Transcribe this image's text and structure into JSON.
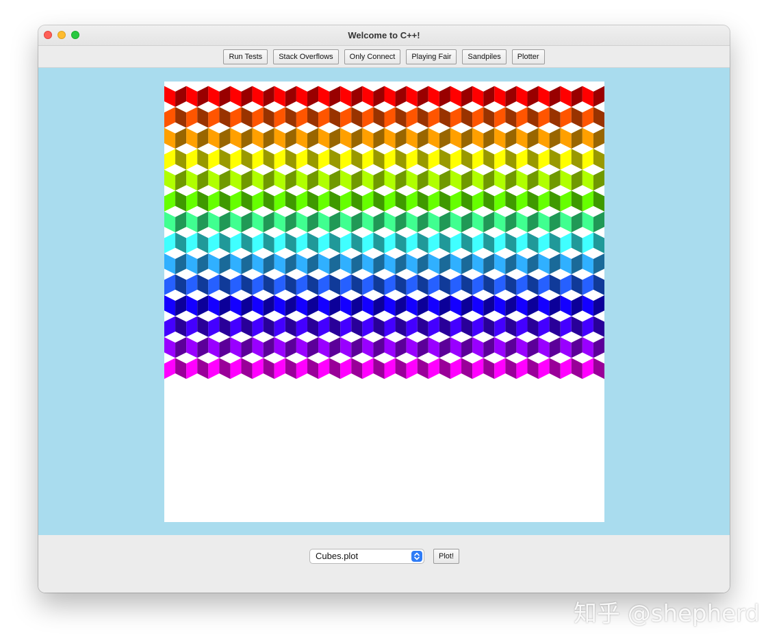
{
  "window": {
    "title": "Welcome to C++!"
  },
  "toolbar": {
    "buttons": [
      {
        "label": "Run Tests"
      },
      {
        "label": "Stack Overflows"
      },
      {
        "label": "Only Connect"
      },
      {
        "label": "Playing Fair"
      },
      {
        "label": "Sandpiles"
      },
      {
        "label": "Plotter"
      }
    ]
  },
  "plot": {
    "pattern": "isometric-cubes",
    "top_face_color": "#ffffff",
    "row_colors": [
      {
        "left": "#ff0000",
        "right": "#990000"
      },
      {
        "left": "#993300",
        "right": "#ff5500"
      },
      {
        "left": "#ffa000",
        "right": "#996600"
      },
      {
        "left": "#999900",
        "right": "#ffff00"
      },
      {
        "left": "#b0ff00",
        "right": "#709900"
      },
      {
        "left": "#3f9900",
        "right": "#66ff00"
      },
      {
        "left": "#40ff90",
        "right": "#209956"
      },
      {
        "left": "#209999",
        "right": "#40ffff"
      },
      {
        "left": "#30b0ff",
        "right": "#1a6a99"
      },
      {
        "left": "#103a99",
        "right": "#2660ff"
      },
      {
        "left": "#1400ff",
        "right": "#0c0099"
      },
      {
        "left": "#290099",
        "right": "#4400ff"
      },
      {
        "left": "#9900ff",
        "right": "#5c0099"
      },
      {
        "left": "#990099",
        "right": "#ff00ff"
      }
    ]
  },
  "bottom": {
    "file_select": {
      "value": "Cubes.plot"
    },
    "plot_button": {
      "label": "Plot!"
    }
  },
  "watermark": {
    "text": "知乎 @shepherd"
  }
}
